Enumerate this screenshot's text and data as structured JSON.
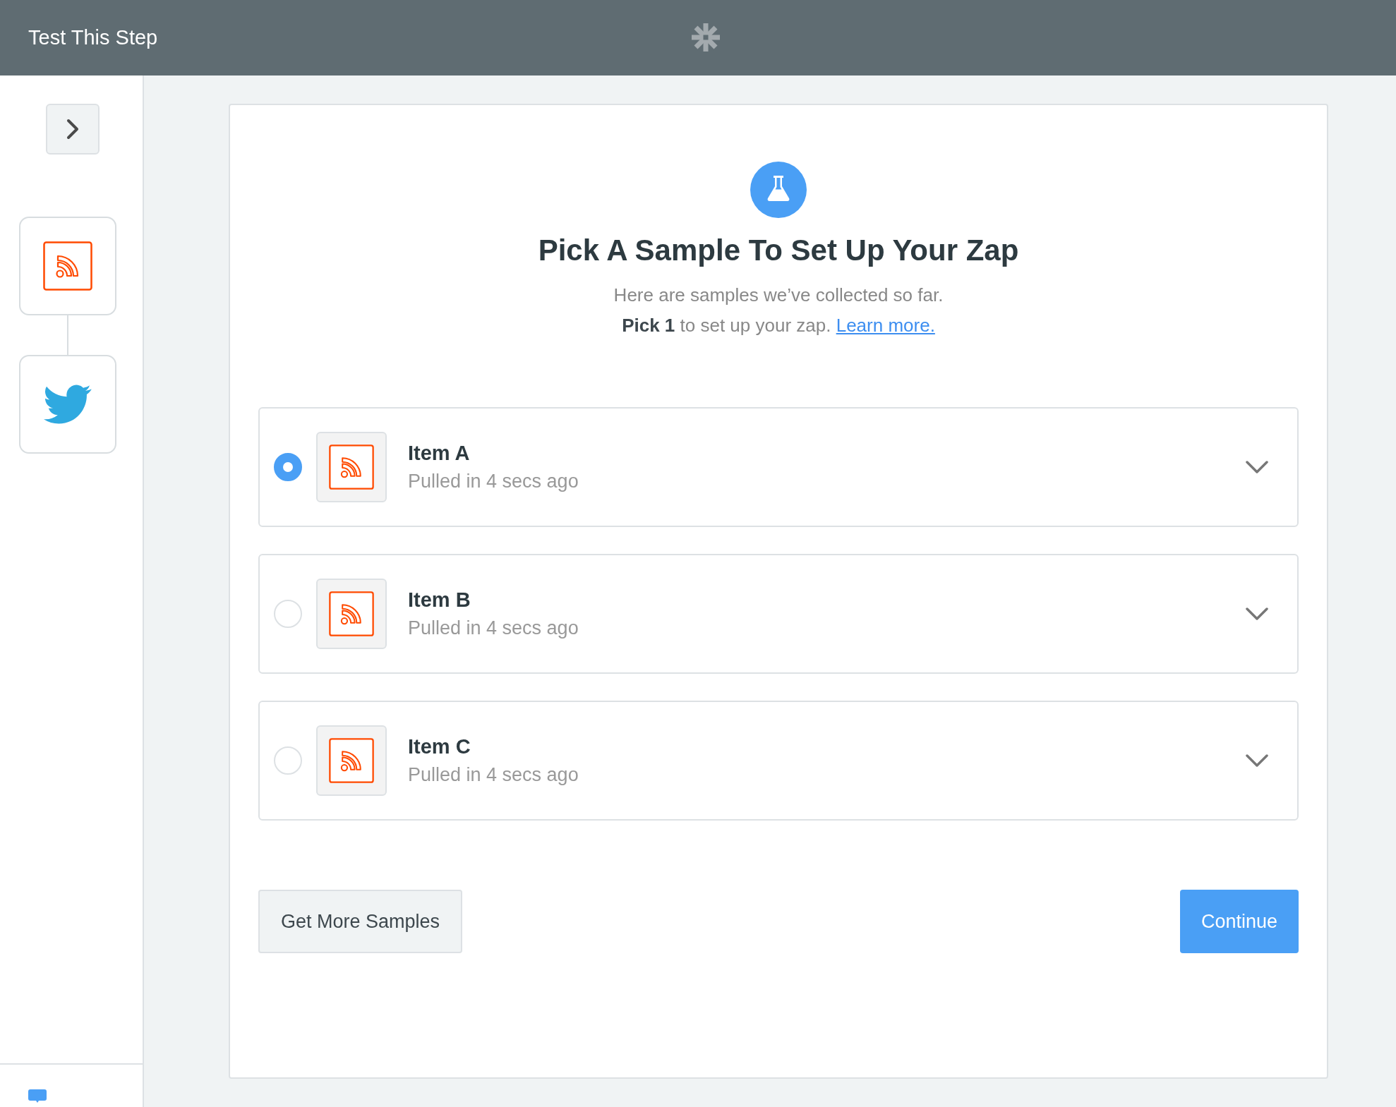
{
  "header": {
    "title": "Test This Step"
  },
  "sidebar": {
    "steps": [
      {
        "kind": "rss"
      },
      {
        "kind": "twitter"
      }
    ]
  },
  "card": {
    "heading": "Pick A Sample To Set Up Your Zap",
    "subtitle": "Here are samples we’ve collected so far.",
    "instruction": "**Pick 1** to set up your zap.",
    "link": "Learn more."
  },
  "samples": [
    {
      "name": "Item A",
      "detail": "Pulled in 4 secs ago",
      "selected": true
    },
    {
      "name": "Item B",
      "detail": "Pulled in 4 secs ago",
      "selected": false
    },
    {
      "name": "Item C",
      "detail": "Pulled in 4 secs ago",
      "selected": false
    }
  ],
  "buttons": {
    "secondary": "Get More Samples",
    "primary": "Continue"
  }
}
